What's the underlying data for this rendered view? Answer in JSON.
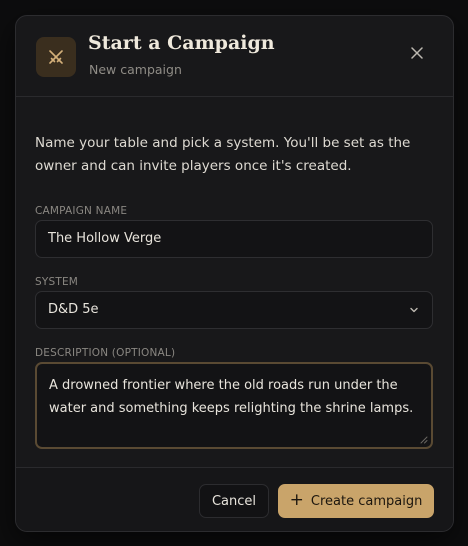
{
  "dialog": {
    "title": "Start a Campaign",
    "subtitle": "New campaign",
    "header_icon": "crossed-swords-icon",
    "close_icon": "close-icon"
  },
  "intro_text": "Name your table and pick a system. You'll be set as the owner and can invite players once it's created.",
  "form": {
    "name_label": "CAMPAIGN NAME",
    "name_value": "The Hollow Verge",
    "system_label": "SYSTEM",
    "system_value": "D&D 5e",
    "description_label": "DESCRIPTION (OPTIONAL)",
    "description_value": "A drowned frontier where the old roads run under the water and something keeps relighting the shrine lamps."
  },
  "footer": {
    "cancel_label": "Cancel",
    "create_label": "Create campaign",
    "create_icon": "+"
  },
  "colors": {
    "accent": "#c9a46a",
    "background": "#18181a",
    "icon_tile": "#3a2e1e",
    "focus_border": "#5a4a33"
  }
}
